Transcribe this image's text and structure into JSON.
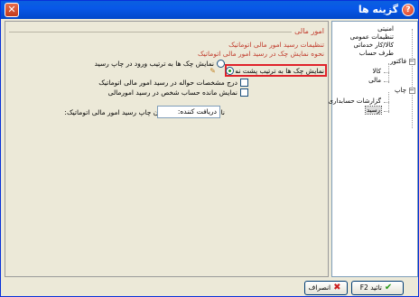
{
  "window": {
    "title": "گزینه ها",
    "help_glyph": "?",
    "close_glyph": "✕"
  },
  "tree": {
    "items": [
      {
        "label": "امنیتی"
      },
      {
        "label": "تنظیمات عمومی"
      },
      {
        "label": "کالا/کار خدماتی"
      },
      {
        "label": "طرف حساب"
      },
      {
        "label": "فاکتور",
        "expand": "−"
      },
      {
        "label": "کالا"
      },
      {
        "label": "مالی"
      },
      {
        "label": "چاپ",
        "expand": "−"
      },
      {
        "label": "گزارشات حسابداری"
      },
      {
        "label": "رسید",
        "selected": true
      }
    ]
  },
  "main": {
    "section_title": "امور مالی",
    "heading": "تنظیمات رسید امور مالی اتوماتیک",
    "subheading": "نحوه نمایش چک در رسید امور مالی اتوماتیک",
    "radio_1": {
      "label": "نمایش چک ها به ترتیب ورود در چاپ رسید",
      "checked": false
    },
    "radio_2": {
      "label": "نمایش چک ها به ترتیب پشت نمره در چاپ رسید",
      "checked": true
    },
    "check_1": {
      "label": "درج مشخصات حواله در رسید امور مالی اتوماتیک",
      "checked": false
    },
    "check_2": {
      "label": "نمایش مانده حساب شخص در رسید امورمالی",
      "checked": false
    },
    "receiver_label": "نام دریافت کننده در زمان چاپ رسید امور مالی اتوماتیک:",
    "receiver_value": "دریافت کننده:"
  },
  "buttons": {
    "ok_label": "تائید F2",
    "cancel_label": "انصراف"
  },
  "colors": {
    "titlebar": "#0858e8",
    "section_title": "#c03a2b",
    "highlight_border": "#e0222a"
  }
}
